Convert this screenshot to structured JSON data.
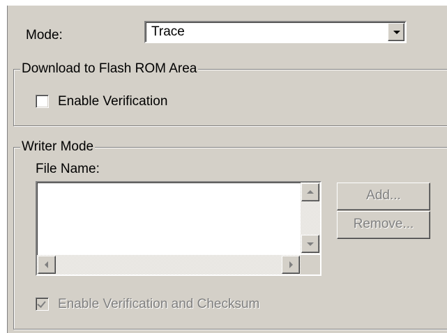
{
  "mode": {
    "label": "Mode:",
    "value": "Trace"
  },
  "download_group": {
    "title": "Download to Flash ROM Area",
    "enable_verification": {
      "label": "Enable Verification",
      "checked": false
    }
  },
  "writer_group": {
    "title": "Writer Mode",
    "file_name_label": "File Name:",
    "add_button": "Add...",
    "remove_button": "Remove...",
    "checksum": {
      "label": "Enable Verification and Checksum",
      "checked": true,
      "disabled": true
    }
  },
  "colors": {
    "face": "#d4d0c8",
    "shadow": "#808080",
    "highlight": "#ffffff",
    "dark": "#404040"
  }
}
